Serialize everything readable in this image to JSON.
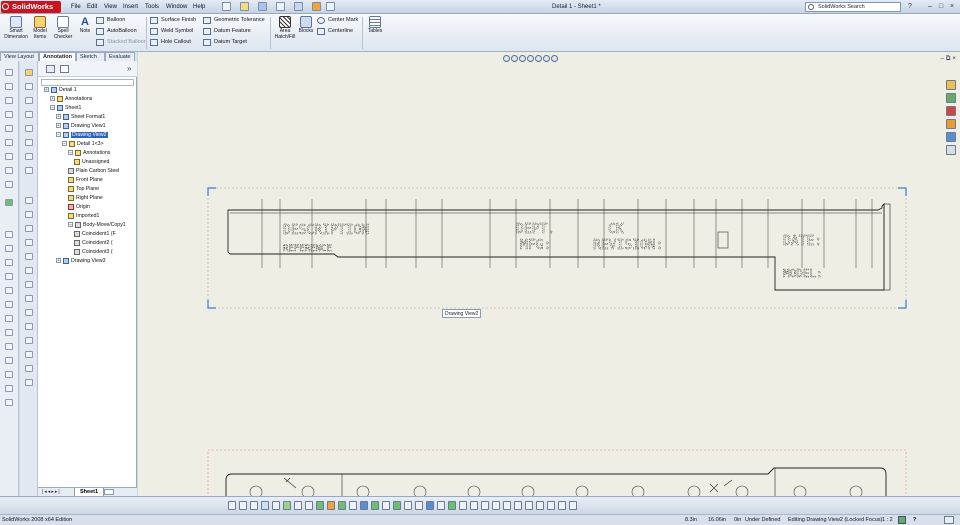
{
  "app": {
    "name": "SolidWorks",
    "window_title": "Detail 1 - Sheet1 *",
    "menu": [
      "File",
      "Edit",
      "View",
      "Insert",
      "Tools",
      "Window",
      "Help"
    ],
    "search_placeholder": "SolidWorks Search",
    "help_symbol": "?",
    "win_controls": [
      "–",
      "□",
      "×"
    ]
  },
  "ribbon": {
    "smart_dimension": "Smart Dimension",
    "model_items": "Model Items",
    "spell_checker": "Spell Checker",
    "note": "Note",
    "balloon": "Balloon",
    "autoballoon": "AutoBalloon",
    "bom_balloon": "Stacked Balloon",
    "surface_finish": "Surface Finish",
    "weld_symbol": "Weld Symbol",
    "hole_callout": "Hole Callout",
    "geometric_tolerance": "Geometric Tolerance",
    "datum_feature": "Datum Feature",
    "datum_target": "Datum Target",
    "area_hatch": "Area Hatch/Fill",
    "blocks": "Blocks",
    "center_mark": "Center Mark",
    "centerline": "Centerline",
    "tables": "Tables"
  },
  "panel_tabs": [
    "View Layout",
    "Annotation",
    "Sketch",
    "Evaluate"
  ],
  "active_panel_tab": "Annotation",
  "feature_tree": [
    {
      "label": "Detail 1",
      "icon": "drawing-icon"
    },
    {
      "label": "Annotations",
      "icon": "annotations-icon"
    },
    {
      "label": "Sheet1",
      "icon": "sheet-icon"
    },
    {
      "label": "Sheet Format1",
      "icon": "sheet-format-icon"
    },
    {
      "label": "Drawing View1",
      "icon": "drawing-view-icon"
    },
    {
      "label": "Drawing View2",
      "icon": "drawing-view-icon",
      "selected": true
    },
    {
      "label": "Detail 1<3>",
      "icon": "part-icon"
    },
    {
      "label": "Annotations",
      "icon": "annotations-icon"
    },
    {
      "label": "Unassigned",
      "icon": "unassigned-icon"
    },
    {
      "label": "Plain Carbon Steel",
      "icon": "material-icon"
    },
    {
      "label": "Front Plane",
      "icon": "plane-icon"
    },
    {
      "label": "Top Plane",
      "icon": "plane-icon"
    },
    {
      "label": "Right Plane",
      "icon": "plane-icon"
    },
    {
      "label": "Origin",
      "icon": "origin-icon"
    },
    {
      "label": "Imported1",
      "icon": "imported-icon"
    },
    {
      "label": "Body-Move/Copy1",
      "icon": "move-body-icon"
    },
    {
      "label": "Coincident1 (F",
      "icon": "mate-icon"
    },
    {
      "label": "Coincident2 (",
      "icon": "mate-icon"
    },
    {
      "label": "Coincident3 (",
      "icon": "mate-icon"
    },
    {
      "label": "Drawing View3",
      "icon": "drawing-view-icon"
    }
  ],
  "sheet_tab": "Sheet1",
  "canvas": {
    "view_label": "Drawing View2",
    "block_text": {
      "description": "DESCRIPTION",
      "reference": "REFERENCE",
      "dept": "DEPT.",
      "mfg": "MFG:",
      "ck": "CK",
      "revision": "REVISION:",
      "date": "DATE:",
      "model": "MODEL:"
    }
  },
  "status": {
    "edition": "SolidWorks 2008 x64 Edition",
    "x": "8.3in",
    "y": "16.06in",
    "z": "0in",
    "defined": "Under Defined",
    "editing": "Editing Drawing View2 (Locked Focus)",
    "scale": "1 : 2",
    "help": "?"
  }
}
